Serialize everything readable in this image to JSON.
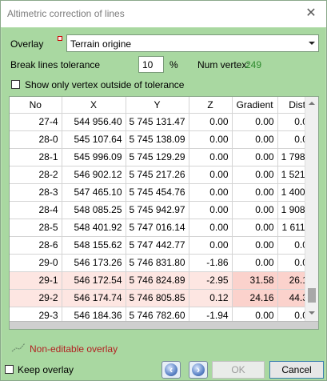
{
  "window": {
    "title": "Altimetric correction of lines"
  },
  "overlay": {
    "label": "Overlay",
    "value": "Terrain origine"
  },
  "tolerance": {
    "label": "Break lines tolerance",
    "value": "10",
    "unit": "%",
    "num_vertex_label": "Num vertex:",
    "num_vertex_value": "249"
  },
  "show_outside": {
    "label": "Show only vertex outside of tolerance",
    "checked": false
  },
  "table": {
    "columns": [
      "No",
      "X",
      "Y",
      "Z",
      "Gradient",
      "Dist"
    ],
    "rows": [
      [
        "27-4",
        "544 956.40",
        "5 745 131.47",
        "0.00",
        "0.00",
        "0.00"
      ],
      [
        "28-0",
        "545 107.64",
        "5 745 138.09",
        "0.00",
        "0.00",
        "0.00"
      ],
      [
        "28-1",
        "545 996.09",
        "5 745 129.29",
        "0.00",
        "0.00",
        "1 798..."
      ],
      [
        "28-2",
        "546 902.12",
        "5 745 217.26",
        "0.00",
        "0.00",
        "1 521..."
      ],
      [
        "28-3",
        "547 465.10",
        "5 745 454.76",
        "0.00",
        "0.00",
        "1 400..."
      ],
      [
        "28-4",
        "548 085.25",
        "5 745 942.97",
        "0.00",
        "0.00",
        "1 908..."
      ],
      [
        "28-5",
        "548 401.92",
        "5 747 016.14",
        "0.00",
        "0.00",
        "1 611..."
      ],
      [
        "28-6",
        "548 155.62",
        "5 747 442.77",
        "0.00",
        "0.00",
        "0.00"
      ],
      [
        "29-0",
        "546 173.26",
        "5 746 831.80",
        "-1.86",
        "0.00",
        "0.00"
      ],
      [
        "29-1",
        "546 172.54",
        "5 746 824.89",
        "-2.95",
        "31.58",
        "26.12"
      ],
      [
        "29-2",
        "546 174.74",
        "5 746 805.85",
        "0.12",
        "24.16",
        "44.33"
      ],
      [
        "29-3",
        "546 184.36",
        "5 746 782.60",
        "-1.94",
        "0.00",
        "0.00"
      ]
    ]
  },
  "non_editable": {
    "label": "Non-editable overlay",
    "color": "#b22222"
  },
  "keep_overlay": {
    "label": "Keep overlay",
    "checked": false
  },
  "buttons": {
    "ok": "OK",
    "cancel": "Cancel",
    "prev_icon": "previous-icon",
    "next_icon": "next-icon"
  },
  "colors": {
    "background": "#a9d8a1",
    "highlight_row": "#fde6e2",
    "highlight_cell": "#fbd2cc",
    "num_vertex": "#2e8b2e"
  }
}
